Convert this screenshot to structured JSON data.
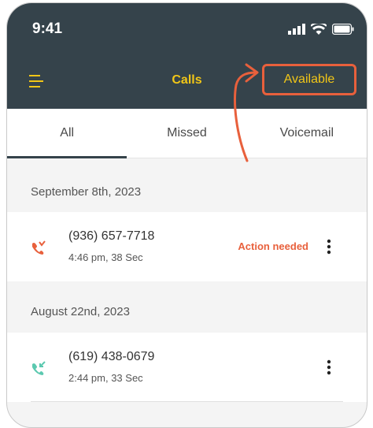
{
  "status_bar": {
    "time": "9:41"
  },
  "header": {
    "title": "Calls",
    "availability": "Available"
  },
  "tabs": [
    {
      "label": "All",
      "active": true
    },
    {
      "label": "Missed",
      "active": false
    },
    {
      "label": "Voicemail",
      "active": false
    }
  ],
  "sections": [
    {
      "date": "September 8th, 2023",
      "calls": [
        {
          "number": "(936) 657-7718",
          "meta": "4:46 pm, 38 Sec",
          "status": "Action needed",
          "icon": "missed-call-icon"
        }
      ]
    },
    {
      "date": "August 22nd, 2023",
      "calls": [
        {
          "number": "(619) 438-0679",
          "meta": "2:44 pm, 33 Sec",
          "status": "",
          "icon": "incoming-call-icon"
        }
      ]
    }
  ],
  "colors": {
    "header": "#35434b",
    "accent": "#f1c617",
    "alert": "#e8603c",
    "incoming": "#5cc9b0"
  }
}
